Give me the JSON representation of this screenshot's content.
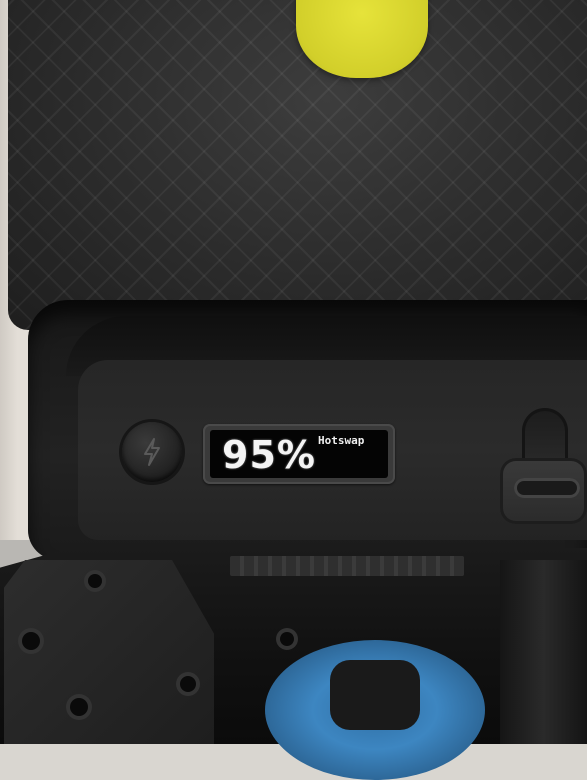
{
  "display": {
    "percent": "95%",
    "mode": "Hotswap"
  },
  "colors": {
    "housing": "#2b2b2b",
    "accent_button": "#d2cf2a",
    "oled_text": "#f4f4f4",
    "wheel": "#3d86c1"
  },
  "icons": {
    "power_button_icon": "lightning-bolt-icon"
  }
}
